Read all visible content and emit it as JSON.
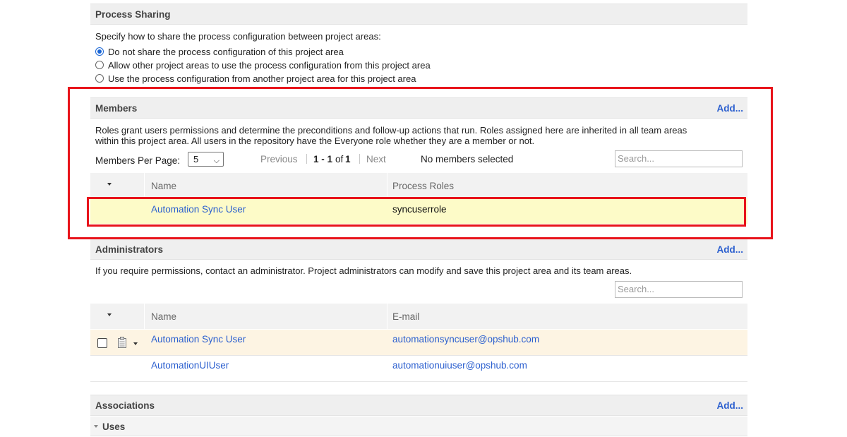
{
  "process_sharing": {
    "title": "Process Sharing",
    "description": "Specify how to share the process configuration between project areas:",
    "options": [
      {
        "label": "Do not share the process configuration of this project area",
        "selected": true
      },
      {
        "label": "Allow other project areas to use the process configuration from this project area",
        "selected": false
      },
      {
        "label": "Use the process configuration from another project area for this project area",
        "selected": false
      }
    ]
  },
  "members": {
    "title": "Members",
    "add_label": "Add...",
    "description_line1": "Roles grant users permissions and determine the preconditions and follow-up actions that run. Roles assigned here are inherited in all team areas",
    "description_line2": "within this project area. All users in the repository have the Everyone role whether they are a member or not.",
    "per_page_label": "Members Per Page:",
    "per_page_value": "5",
    "pager": {
      "previous": "Previous",
      "range": "1 - 1",
      "of": "of",
      "total": "1",
      "next": "Next"
    },
    "selection_status": "No members selected",
    "search_placeholder": "Search...",
    "columns": [
      "Name",
      "Process Roles"
    ],
    "rows": [
      {
        "name": "Automation Sync User",
        "roles": "syncuserrole"
      }
    ]
  },
  "administrators": {
    "title": "Administrators",
    "add_label": "Add...",
    "description": "If you require permissions, contact an administrator. Project administrators can modify and save this project area and its team areas.",
    "search_placeholder": "Search...",
    "columns": [
      "Name",
      "E-mail"
    ],
    "rows": [
      {
        "name": "Automation Sync User",
        "email": "automationsyncuser@opshub.com"
      },
      {
        "name": "AutomationUIUser",
        "email": "automationuiuser@opshub.com"
      }
    ]
  },
  "associations": {
    "title": "Associations",
    "add_label": "Add...",
    "uses_label": "Uses"
  },
  "colors": {
    "link": "#2b5fcf",
    "highlight_red": "#e8141b",
    "selected_row": "#fdfbc8",
    "hover_row": "#fdf4e3"
  }
}
